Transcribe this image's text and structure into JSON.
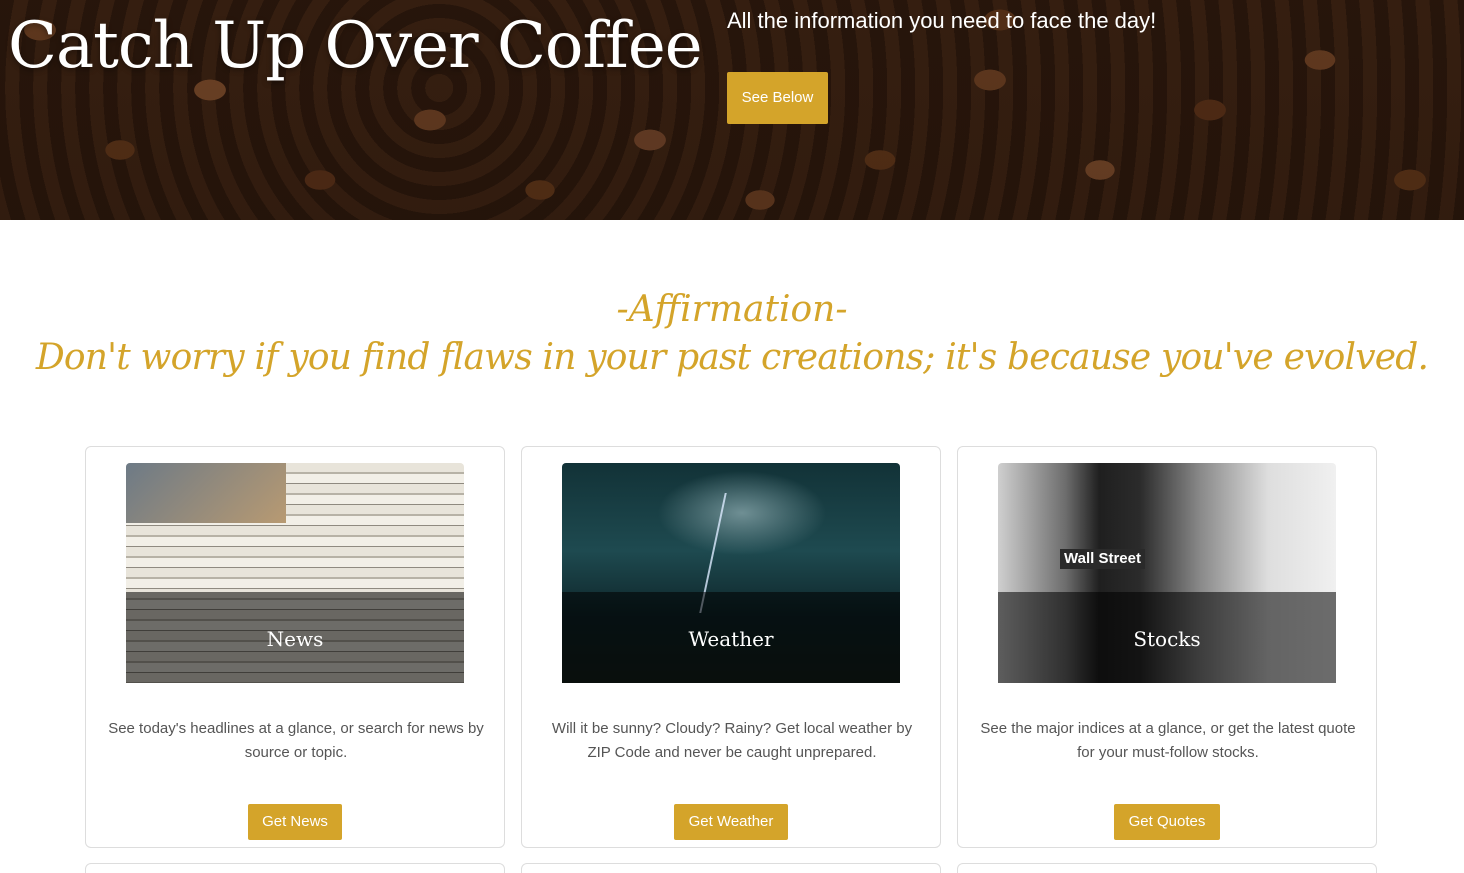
{
  "hero": {
    "title": "Catch Up Over Coffee",
    "tagline": "All the information you need to face the day!",
    "button_label": "See Below"
  },
  "affirmation": {
    "heading": "-Affirmation-",
    "text": "Don't worry if you find flaws in your past creations; it's because you've evolved."
  },
  "cards": [
    {
      "title": "News",
      "description": "See today's headlines at a glance, or search for news by source or topic.",
      "button_label": "Get News"
    },
    {
      "title": "Weather",
      "description": "Will it be sunny? Cloudy? Rainy? Get local weather by ZIP Code and never be caught unprepared.",
      "button_label": "Get Weather"
    },
    {
      "title": "Stocks",
      "description": "See the major indices at a glance, or get the latest quote for your must-follow stocks.",
      "button_label": "Get Quotes",
      "image_sign": "Wall Street"
    }
  ],
  "colors": {
    "accent": "#d4a42a",
    "text": "#555555",
    "card_border": "#dddddd"
  }
}
